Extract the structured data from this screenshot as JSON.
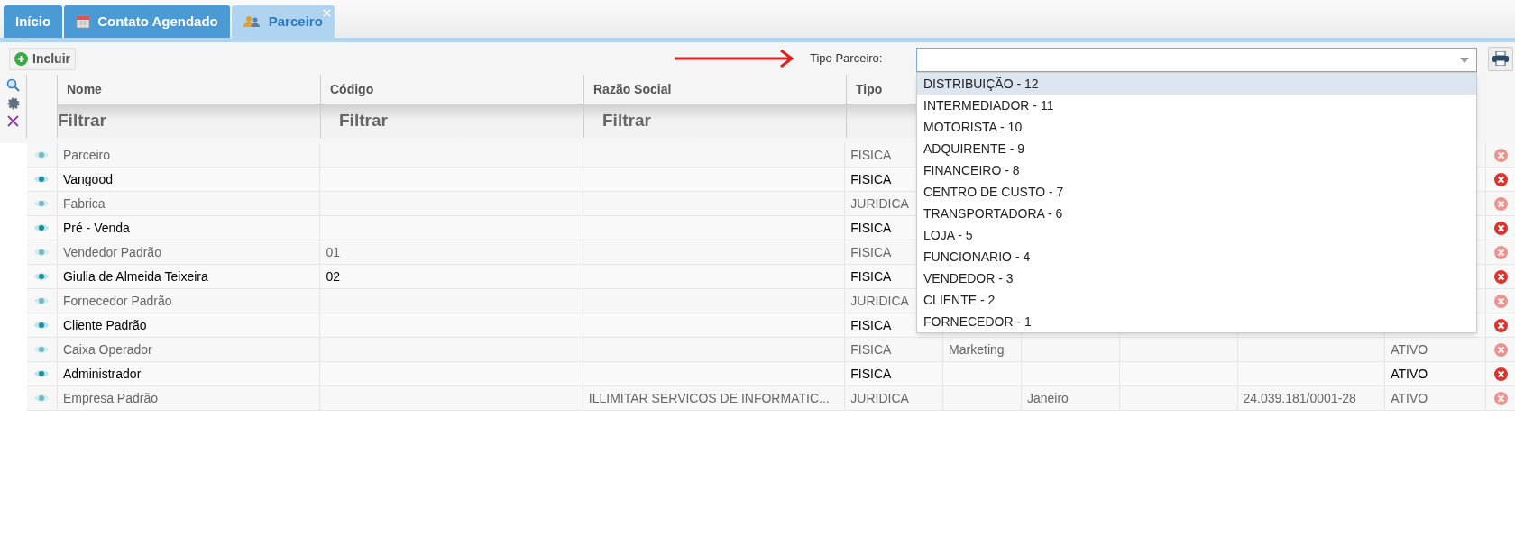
{
  "tabs": [
    {
      "label": "Início",
      "selected": false,
      "closable": false
    },
    {
      "label": "Contato Agendado",
      "selected": false,
      "closable": false
    },
    {
      "label": "Parceiro",
      "selected": true,
      "closable": true
    }
  ],
  "toolbar": {
    "add_button": "Incluir",
    "filter_label": "Tipo Parceiro:"
  },
  "dropdown": {
    "expanded": true,
    "options": [
      {
        "label": "DISTRIBUIÇÃO - 12",
        "selected": true
      },
      {
        "label": "INTERMEDIADOR - 11",
        "selected": false
      },
      {
        "label": "MOTORISTA - 10",
        "selected": false
      },
      {
        "label": "ADQUIRENTE - 9",
        "selected": false
      },
      {
        "label": "FINANCEIRO - 8",
        "selected": false
      },
      {
        "label": "CENTRO DE CUSTO - 7",
        "selected": false
      },
      {
        "label": "TRANSPORTADORA - 6",
        "selected": false
      },
      {
        "label": "LOJA - 5",
        "selected": false
      },
      {
        "label": "FUNCIONARIO - 4",
        "selected": false
      },
      {
        "label": "VENDEDOR - 3",
        "selected": false
      },
      {
        "label": "CLIENTE - 2",
        "selected": false
      },
      {
        "label": "FORNECEDOR - 1",
        "selected": false
      }
    ]
  },
  "table": {
    "columns": [
      "Nome",
      "Código",
      "Razão Social",
      "Tipo"
    ],
    "filter_placeholders": [
      "Filtrar",
      "Filtrar",
      "Filtrar"
    ],
    "rows": [
      {
        "nome": "Parceiro",
        "tipo": "FISICA"
      },
      {
        "nome": "Vangood",
        "tipo": "FISICA"
      },
      {
        "nome": "Fabrica",
        "tipo": "JURIDICA"
      },
      {
        "nome": "Pré - Venda",
        "tipo": "FISICA"
      },
      {
        "nome": "Vendedor Padrão",
        "codigo": "01",
        "tipo": "FISICA"
      },
      {
        "nome": "Giulia de Almeida Teixeira",
        "codigo": "02",
        "tipo": "FISICA"
      },
      {
        "nome": "Fornecedor Padrão",
        "tipo": "JURIDICA"
      },
      {
        "nome": "Cliente Padrão",
        "tipo": "FISICA"
      },
      {
        "nome": "Caixa Operador",
        "tipo": "FISICA",
        "column_5": "Marketing",
        "column_9": "ATIVO"
      },
      {
        "nome": "Administrador",
        "tipo": "FISICA",
        "column_9": "ATIVO"
      },
      {
        "nome": "Empresa Padrão",
        "razao_social": "ILLIMITAR SERVICOS DE INFORMATIC...",
        "tipo": "JURIDICA",
        "column_6": "Janeiro",
        "column_8": "24.039.181/0001-28",
        "column_9": "ATIVO"
      }
    ]
  }
}
